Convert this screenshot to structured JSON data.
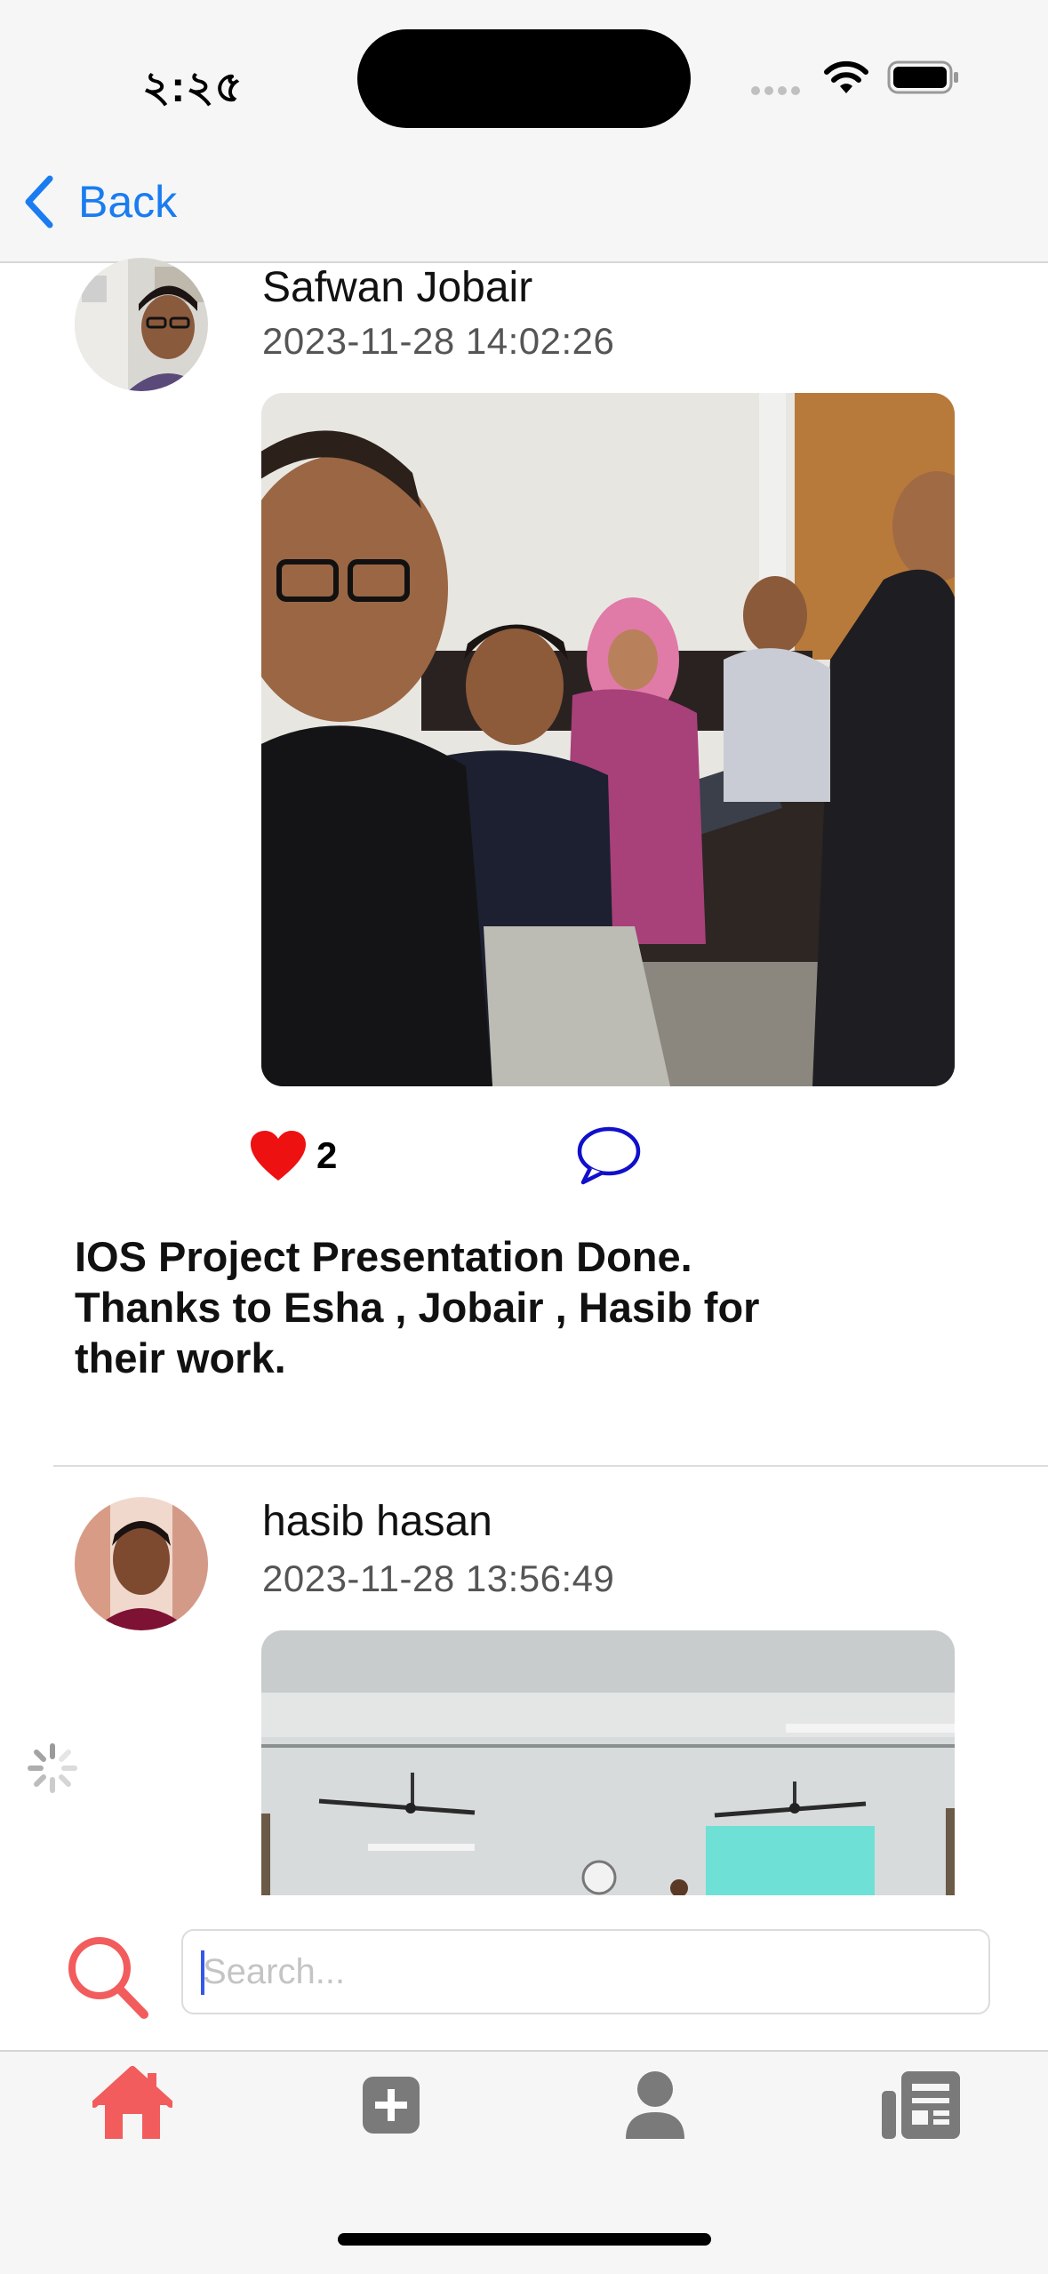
{
  "status_bar": {
    "time": "২:২৫"
  },
  "nav": {
    "back_label": "Back"
  },
  "posts": [
    {
      "author": "Safwan Jobair",
      "timestamp": "2023-11-28 14:02:26",
      "likes": "2",
      "caption": "IOS Project Presentation Done. Thanks to Esha , Jobair , Hasib for their work."
    },
    {
      "author": "hasib hasan",
      "timestamp": "2023-11-28 13:56:49"
    }
  ],
  "search": {
    "placeholder": "Search..."
  },
  "tabs": [
    {
      "icon": "home-icon",
      "active": true
    },
    {
      "icon": "plus-icon",
      "active": false
    },
    {
      "icon": "person-icon",
      "active": false
    },
    {
      "icon": "news-icon",
      "active": false
    }
  ],
  "colors": {
    "accent": "#f25c5c",
    "link": "#1a7cf0",
    "heart": "#ee1111",
    "comment": "#1010cc"
  }
}
